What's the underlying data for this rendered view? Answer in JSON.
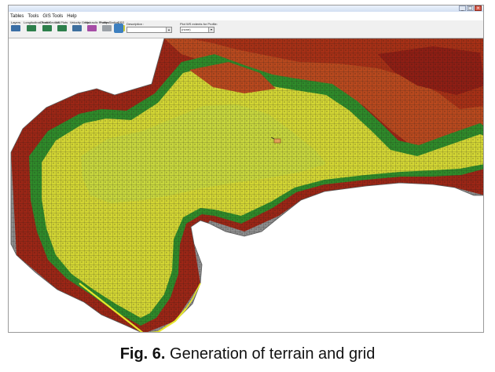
{
  "window": {
    "controls": [
      "_",
      "□",
      "×"
    ]
  },
  "menu": [
    "Tables",
    "Tools",
    "GIS Tools",
    "Help"
  ],
  "toolbar": {
    "buttons": [
      {
        "label": "Layers"
      },
      {
        "label": "Longitudinal Profile"
      },
      {
        "label": "Cross Section"
      },
      {
        "label": "XS Plots"
      },
      {
        "label": "Velocity Grids"
      },
      {
        "label": "Hydraulic Profiles"
      },
      {
        "label": "Pump Station"
      },
      {
        "label": "DSS"
      }
    ],
    "description_label": "Description :",
    "plot_label": "Plot WS extents for Profile:",
    "plot_value": "(none)"
  },
  "colors": {
    "yellow": "#d8d83a",
    "green": "#3d8a2a",
    "red": "#8a1a12",
    "gray": "#8a8a8a"
  },
  "caption": {
    "fig": "Fig. 6.",
    "text": " Generation of terrain and grid"
  }
}
